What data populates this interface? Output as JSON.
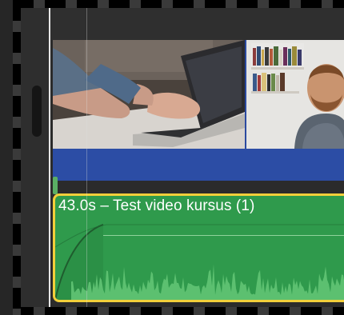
{
  "audio_clip": {
    "title": "43.0s – Test video kursus (1)"
  },
  "colors": {
    "audio_clip": "#2f9a4c",
    "selection_border": "#f2cf3a",
    "video_clip": "#2c4da5"
  },
  "icons": [
    "scroll-handle",
    "volume-fade-handle"
  ]
}
